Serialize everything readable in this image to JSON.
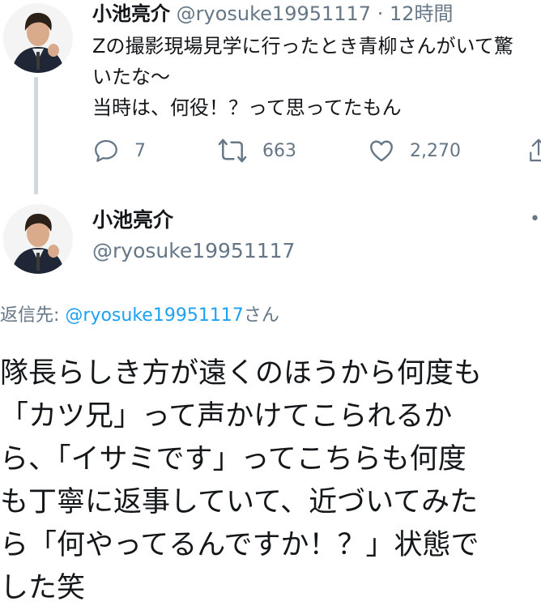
{
  "tweet1": {
    "display_name": "小池亮介",
    "handle": "@ryosuke19951117",
    "separator": "·",
    "time": "12時間",
    "text_lines": [
      "Zの撮影現場見学に行ったとき青柳さんがいて驚",
      "いたな〜",
      "当時は、何役！？って思ってたもん"
    ],
    "actions": {
      "reply_count": "7",
      "retweet_count": "663",
      "like_count": "2,270"
    }
  },
  "tweet2": {
    "display_name": "小池亮介",
    "handle": "@ryosuke19951117",
    "more": "••",
    "reply_to_prefix": "返信先: ",
    "reply_to_handle": "@ryosuke19951117",
    "reply_to_suffix": "さん",
    "text_lines": [
      "隊長らしき方が遠くのほうから何度も",
      "「カツ兄」って声かけてこられるか",
      "ら、「イサミです」ってこちらも何度",
      "も丁寧に返事していて、近づいてみた",
      "ら「何やってるんですか！？」状態で",
      "した笑"
    ]
  },
  "colors": {
    "muted": "#657786",
    "link": "#1da1f2",
    "thread_line": "#cfd9de",
    "text": "#14171a"
  },
  "icons": {
    "reply": "reply-icon",
    "retweet": "retweet-icon",
    "like": "heart-icon",
    "share": "share-icon",
    "more": "more-icon"
  }
}
